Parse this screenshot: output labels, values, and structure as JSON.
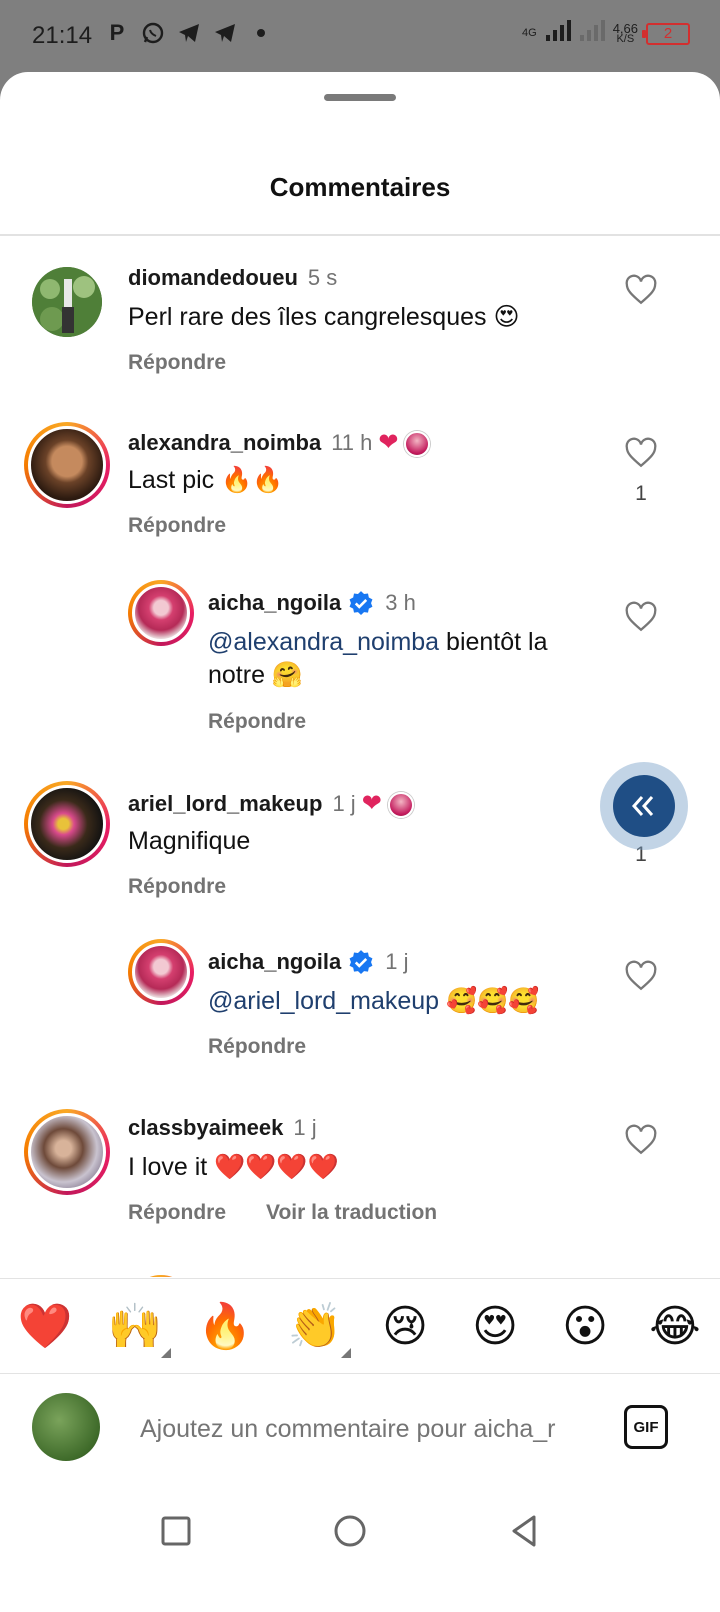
{
  "status_bar": {
    "time": "21:14",
    "left_icons": [
      "P",
      "whatsapp-icon",
      "telegram-icon",
      "telegram-icon",
      "dot"
    ],
    "network": "4G",
    "speed_value": "4,66",
    "speed_unit": "K/S",
    "battery": "2"
  },
  "sheet": {
    "title": "Commentaires"
  },
  "comments": [
    {
      "username": "diomandedoueu",
      "time": "5 s",
      "text": "Perl rare des îles cangrelesques 😍",
      "reply": "Répondre",
      "likes": ""
    },
    {
      "username": "alexandra_noimba",
      "time": "11 h",
      "text": "Last pic 🔥🔥",
      "reply": "Répondre",
      "likes": "1"
    },
    {
      "username": "aicha_ngoila",
      "time": "3 h",
      "mention": "@alexandra_noimba",
      "text": " bientôt la notre 🤗",
      "reply": "Répondre",
      "likes": ""
    },
    {
      "username": "ariel_lord_makeup",
      "time": "1 j",
      "text": "Magnifique",
      "reply": "Répondre",
      "likes": "1"
    },
    {
      "username": "aicha_ngoila",
      "time": "1 j",
      "mention": "@ariel_lord_makeup",
      "text": " 🥰🥰🥰",
      "reply": "Répondre",
      "likes": ""
    },
    {
      "username": "classbyaimeek",
      "time": "1 j",
      "text": "I love it ❤️❤️❤️❤️",
      "reply": "Répondre",
      "translate": "Voir la traduction",
      "likes": ""
    }
  ],
  "quick_reactions": [
    "❤️",
    "🙌",
    "🔥",
    "👏",
    "😢",
    "😍",
    "😮",
    "😂"
  ],
  "composer": {
    "placeholder": "Ajoutez un commentaire pour aicha_r",
    "gif_label": "GIF"
  },
  "colors": {
    "accent": "#1f4e85",
    "heart": "#e0245e",
    "mention": "#1f3f6e",
    "verified": "#1877f2"
  }
}
